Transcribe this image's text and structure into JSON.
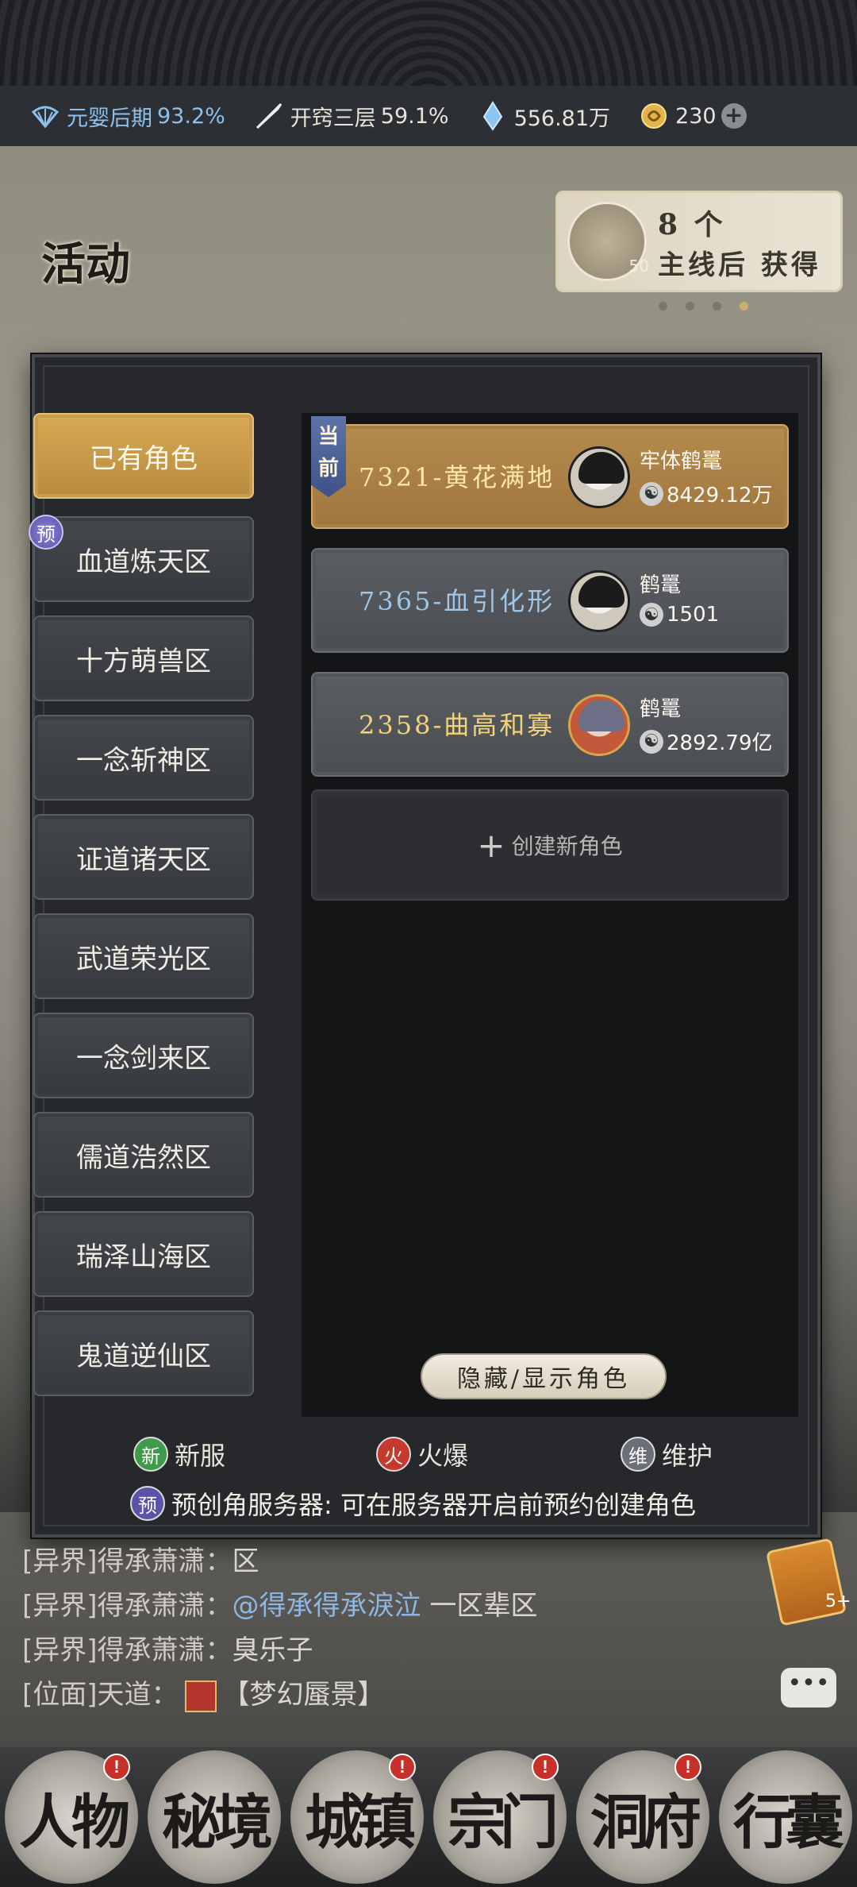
{
  "status": {
    "realm": {
      "label": "元婴后期",
      "pct": "93.2%",
      "color": "#8ec0ee"
    },
    "meridian": {
      "label": "开窍三层",
      "pct": "59.1%"
    },
    "spirit_stones": "556.81万",
    "gold": "230"
  },
  "event": {
    "label": "活动"
  },
  "quest": {
    "icon_level": "50",
    "line1": "8 个",
    "line2": "主线后 获得",
    "pages": 4,
    "current_page": 4
  },
  "servers": [
    {
      "label": "已有角色",
      "active": true
    },
    {
      "label": "血道炼天区",
      "badge": "预"
    },
    {
      "label": "十方萌兽区"
    },
    {
      "label": "一念斩神区"
    },
    {
      "label": "证道诸天区"
    },
    {
      "label": "武道荣光区"
    },
    {
      "label": "一念剑来区"
    },
    {
      "label": "儒道浩然区"
    },
    {
      "label": "瑞泽山海区"
    },
    {
      "label": "鬼道逆仙区"
    }
  ],
  "current_tag": "当前",
  "roles": [
    {
      "server": "7321-",
      "name": "黄花满地",
      "title": "牢体鹤鼍",
      "power": "8429.12万",
      "current": true,
      "title_color": "#fbe7a9"
    },
    {
      "server": "7365-",
      "name": "血引化形",
      "title": "鹤鼍",
      "power": "1501",
      "current": false,
      "title_color": "#9fc6e6"
    },
    {
      "server": "2358-",
      "name": "曲高和寡",
      "title": "鹤鼍",
      "power": "2892.79亿",
      "current": false,
      "title_color": "#f3d37a"
    }
  ],
  "create_role": "创建新角色",
  "hide_button": "隐藏/显示角色",
  "legend": {
    "new": {
      "icon": "新",
      "label": "新服"
    },
    "hot": {
      "icon": "火",
      "label": "火爆"
    },
    "maint": {
      "icon": "维",
      "label": "维护"
    },
    "pre": {
      "icon": "预",
      "label": "预创角服务器: 可在服务器开启前预约创建角色"
    }
  },
  "chat": [
    {
      "prefix": "[异界]得承萧潇：",
      "text": "区"
    },
    {
      "prefix": "[异界]得承萧潇：",
      "link": "@得承得承淚泣",
      "text": "一区辈区"
    },
    {
      "prefix": "[异界]得承萧潇：",
      "text": "臭乐子"
    },
    {
      "prefix": "[位面]天道：",
      "text": "【梦幻蜃景】"
    }
  ],
  "gift_count": "5+",
  "nav": [
    {
      "label": "人物",
      "alert": true
    },
    {
      "label": "秘境",
      "alert": false
    },
    {
      "label": "城镇",
      "alert": true
    },
    {
      "label": "宗门",
      "alert": true
    },
    {
      "label": "洞府",
      "alert": true
    },
    {
      "label": "行囊",
      "alert": false
    }
  ]
}
